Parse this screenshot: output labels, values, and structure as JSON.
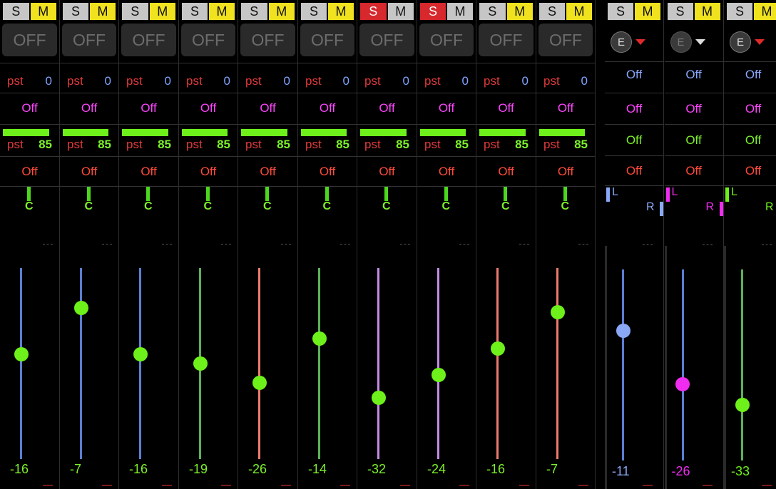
{
  "labels": {
    "solo": "S",
    "mute": "M",
    "off_button": "OFF",
    "pst": "pst",
    "off": "Off",
    "pan_center": "C",
    "left": "L",
    "right": "R",
    "expand": "E"
  },
  "colors": {
    "blue": "#5a7fd2",
    "green": "#5bb25a",
    "salmon": "#ec7b6e",
    "lilac": "#c48be6",
    "knob_green": "#6ef01b",
    "knob_blue": "#89a8f5",
    "knob_magenta": "#f02cf0",
    "off_red": "#ff4a3a",
    "off_magenta": "#ff44ff",
    "off_blue": "#8aa8ff",
    "off_green": "#7df02a",
    "pst_blue": "#7ea4ff",
    "pst_green": "#7df02a"
  },
  "channels": [
    {
      "fader": "-16",
      "solo_active": false,
      "mute_active": true,
      "pst_top": "0",
      "pst_mid": "85",
      "fader_color": "blue",
      "level": 0.55
    },
    {
      "fader": "-7",
      "solo_active": false,
      "mute_active": true,
      "pst_top": "0",
      "pst_mid": "85",
      "fader_color": "blue",
      "level": 0.79
    },
    {
      "fader": "-16",
      "solo_active": false,
      "mute_active": true,
      "pst_top": "0",
      "pst_mid": "85",
      "fader_color": "blue",
      "level": 0.55
    },
    {
      "fader": "-19",
      "solo_active": false,
      "mute_active": true,
      "pst_top": "0",
      "pst_mid": "85",
      "fader_color": "green",
      "level": 0.5
    },
    {
      "fader": "-26",
      "solo_active": false,
      "mute_active": true,
      "pst_top": "0",
      "pst_mid": "85",
      "fader_color": "salmon",
      "level": 0.4
    },
    {
      "fader": "-14",
      "solo_active": false,
      "mute_active": true,
      "pst_top": "0",
      "pst_mid": "85",
      "fader_color": "green",
      "level": 0.63
    },
    {
      "fader": "-32",
      "solo_active": true,
      "mute_active": false,
      "pst_top": "0",
      "pst_mid": "85",
      "fader_color": "lilac",
      "level": 0.32
    },
    {
      "fader": "-24",
      "solo_active": true,
      "mute_active": false,
      "pst_top": "0",
      "pst_mid": "85",
      "fader_color": "lilac",
      "level": 0.44
    },
    {
      "fader": "-16",
      "solo_active": false,
      "mute_active": true,
      "pst_top": "0",
      "pst_mid": "85",
      "fader_color": "salmon",
      "level": 0.58
    },
    {
      "fader": "-7",
      "solo_active": false,
      "mute_active": true,
      "pst_top": "0",
      "pst_mid": "85",
      "fader_color": "salmon",
      "level": 0.77
    }
  ],
  "buses": [
    {
      "fader": "-11",
      "row1": "Off",
      "row2": "Off",
      "row3": "Off",
      "row4": "Off",
      "row1_color": "off_blue",
      "row3_color": "off_green",
      "fader_color": "blue",
      "knob_color": "knob_blue",
      "accent": "knob_blue",
      "level": 0.68,
      "e_dim": false
    },
    {
      "fader": "-26",
      "row1": "Off",
      "row2": "Off",
      "row3": "Off",
      "row4": "Off",
      "row1_color": "off_blue",
      "row3_color": "off_green",
      "fader_color": "blue",
      "knob_color": "knob_magenta",
      "accent": "knob_magenta",
      "level": 0.4,
      "e_dim": true
    },
    {
      "fader": "-33",
      "row1": "Off",
      "row2": "Off",
      "row3": "Off",
      "row4": "Off",
      "row1_color": "off_blue",
      "row3_color": "off_green",
      "fader_color": "green",
      "knob_color": "knob_green",
      "accent": "knob_green",
      "level": 0.29,
      "e_dim": false
    }
  ]
}
